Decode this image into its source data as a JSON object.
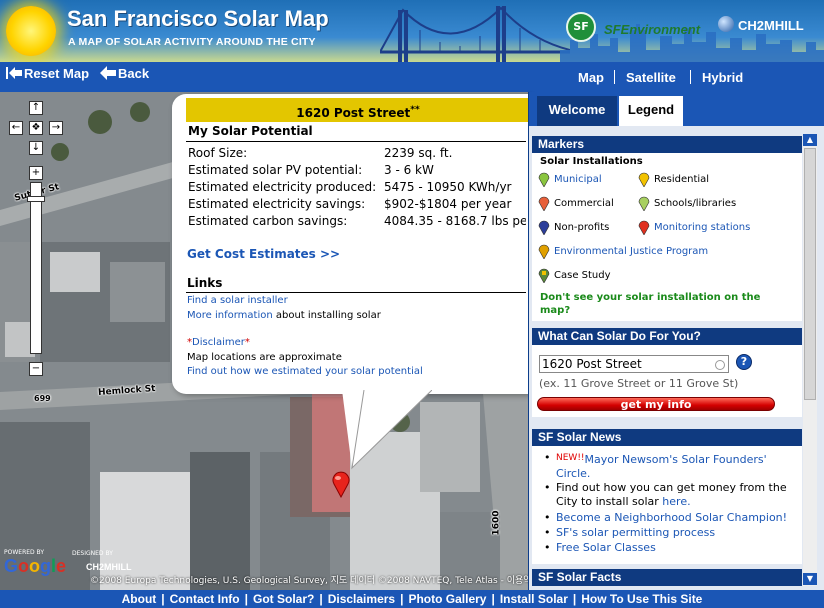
{
  "header": {
    "title": "San Francisco Solar Map",
    "subtitle": "A MAP OF SOLAR ACTIVITY AROUND THE CITY",
    "partner1": "SFEnvironment",
    "partner2": "CH2MHILL"
  },
  "toolbar": {
    "reset_label": "Reset Map",
    "back_label": "Back",
    "map_types": [
      "Map",
      "Satellite",
      "Hybrid"
    ]
  },
  "map": {
    "streets": {
      "sutter": "Sutter St",
      "hemlock": "Hemlock St",
      "polk_num": "1600",
      "num_699": "699"
    },
    "powered_by": "POWERED BY",
    "google": "Google",
    "designed_by": "DESIGNED BY",
    "ch2m": "CH2MHILL",
    "copyright": "©2008 Europa Technologies, U.S. Geological Survey, 지도 데이터 ©2008 NAVTEQ, Tele Atlas - 이용약관"
  },
  "bubble": {
    "address": "1620 Post Street",
    "address_mark": "**",
    "section_title": "My Solar Potential",
    "rows": [
      {
        "label": "Roof Size:",
        "value": "2239 sq. ft."
      },
      {
        "label": "Estimated solar PV potential:",
        "value": "3 - 6 kW"
      },
      {
        "label": "Estimated electricity produced:",
        "value": "5475 - 10950 KWh/yr"
      },
      {
        "label": "Estimated electricity savings:",
        "value": "$902-$1804 per year"
      },
      {
        "label": "Estimated carbon savings:",
        "value": "4084.35 - 8168.7 lbs per"
      }
    ],
    "cost_link": "Get Cost Estimates >>",
    "links_title": "Links",
    "link1": "Find a solar installer",
    "link2": "More information",
    "link2_suffix": " about installing solar",
    "disclaimer_star1": "*",
    "disclaimer": "Disclaimer",
    "disclaimer_star2": "*",
    "disclaimer_note": "Map locations are approximate",
    "estimate_link": "Find out how we estimated your solar potential"
  },
  "panel": {
    "tabs": [
      "Welcome",
      "Legend"
    ],
    "markers_head": "Markers",
    "installations_head": "Solar Installations",
    "legend": [
      {
        "label": "Municipal",
        "color": "#8ac53f",
        "link": true
      },
      {
        "label": "Residential",
        "color": "#f2c200",
        "link": false
      },
      {
        "label": "Commercial",
        "color": "#e8603a",
        "link": false
      },
      {
        "label": "Schools/libraries",
        "color": "#a8d060",
        "link": false
      },
      {
        "label": "Non-profits",
        "color": "#2c3e9a",
        "link": false
      },
      {
        "label": "Monitoring stations",
        "color": "#e03020",
        "link": true
      },
      {
        "label": "Environmental Justice Program",
        "color": "#e0a000",
        "link": true
      },
      {
        "label": "Case Study",
        "color": "#5a8a3a",
        "link": false
      }
    ],
    "dont_see": "Don't see your solar installation on the map?",
    "what_head": "What Can Solar Do For You?",
    "address_value": "1620 Post Street",
    "help": "?",
    "example": "(ex. 11 Grove Street or 11 Grove St)",
    "getinfo": "get my info",
    "news_head": "SF Solar News",
    "news": [
      {
        "new": "NEW!!",
        "link": "Mayor Newsom's Solar Founders' Circle.",
        "text": "",
        "suffix": ""
      },
      {
        "new": "",
        "link": "",
        "text": "Find out how you can get money from the City to install solar ",
        "suffix": "here."
      },
      {
        "new": "",
        "link": "Become a Neighborhood Solar Champion!",
        "text": "",
        "suffix": ""
      },
      {
        "new": "",
        "link": "SF's solar permitting process",
        "text": "",
        "suffix": ""
      },
      {
        "new": "",
        "link": "Free Solar Classes",
        "text": "",
        "suffix": ""
      }
    ],
    "facts_head": "SF Solar Facts"
  },
  "footer": {
    "links": [
      "About",
      "Contact Info",
      "Got Solar?",
      "Disclaimers",
      "Photo Gallery",
      "Install Solar",
      "How To Use This Site"
    ]
  },
  "colors": {
    "brand_blue": "#1b56b5",
    "dark_blue": "#0f3a80",
    "bubble_header": "#e3c600",
    "link_green": "#1a8a1a",
    "button_red": "#d40000"
  }
}
